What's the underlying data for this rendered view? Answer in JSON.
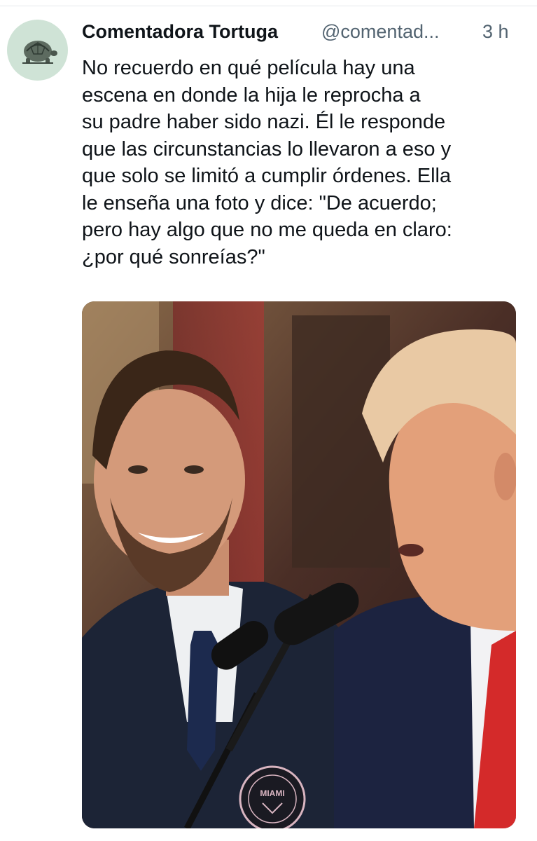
{
  "tweet": {
    "author": {
      "display_name": "Comentadora Tortuga",
      "handle": "@comentad...",
      "avatar_icon": "tortoise-icon"
    },
    "timestamp": "3 h",
    "text_lines": [
      "No recuerdo en qué película hay una",
      "escena en donde la hija le reprocha a",
      "su padre haber sido nazi. Él le responde",
      "que las circunstancias lo llevaron a eso y",
      "que solo se limitó a cumplir órdenes. Ella",
      "le enseña una foto y dice: \"De acuerdo;",
      "pero hay algo que no me queda en claro:",
      "¿por qué sonreías?\""
    ],
    "media": {
      "badge_text": "MIAMI"
    }
  },
  "colors": {
    "text_primary": "#0f1419",
    "text_secondary": "#536471",
    "avatar_bg": "#cfe3d6",
    "divider": "#e6e9ec"
  }
}
